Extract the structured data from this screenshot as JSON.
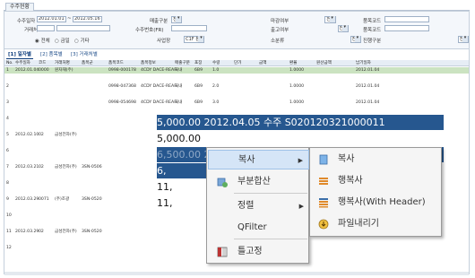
{
  "window": {
    "tab": "수주현황"
  },
  "filter": {
    "date_label": "수주일자",
    "date_from": "2012.01.01",
    "date_sep": "~",
    "date_to": "2012.05.16",
    "client_label": "거래처",
    "radios": [
      "전체",
      "금일",
      "기타"
    ],
    "ship_label": "매출구분",
    "ship_value": "전체",
    "order_label": "수주번호(FR)",
    "biz_label": "사업장",
    "biz_value": "C1F 본사",
    "status1_label": "마감여부",
    "status1_value": "전체",
    "status2_label": "출고여부",
    "status2_value": "전체",
    "status3_label": "소분류",
    "status3_value": "전체",
    "item_label": "품목코드",
    "item2_label": "품목코드",
    "type_label": "진행구분",
    "type_value": "전체"
  },
  "subtabs": [
    "[1] 일자별",
    "[2] 품목별",
    "[3] 거래처별"
  ],
  "grid": {
    "headers": [
      "No.",
      "수주일자",
      "코드",
      "거래처명",
      "품목군",
      "품목코드",
      "품목정보",
      "매출구분",
      "포장",
      "수량",
      "단가",
      "금액",
      "환율",
      "원산금액",
      "납기일자"
    ],
    "rows": [
      [
        "1",
        "2012.01.04",
        "0000",
        "원자재(주)",
        "",
        "0998-000178",
        "4CDY DACE-REAR",
        "국내",
        "6B9",
        "1.0",
        "",
        "",
        "1.0000",
        "",
        "2012.01.04"
      ],
      [
        "2",
        "",
        "",
        "",
        "",
        "0998-047368",
        "4CDY DACE-REAR",
        "국내",
        "6B9",
        "2.0",
        "",
        "",
        "1.0000",
        "",
        "2012.01.04"
      ],
      [
        "3",
        "",
        "",
        "",
        "",
        "0998-054698",
        "4CDY DACE-REAR",
        "국내",
        "6B9",
        "3.0",
        "",
        "",
        "1.0000",
        "",
        "2012.01.04"
      ],
      [
        "4",
        "",
        "",
        "",
        "",
        "",
        "",
        "",
        "",
        "",
        "",
        "",
        "",
        "",
        ""
      ],
      [
        "5",
        "2012.02.10",
        "02",
        "금성전자(주)",
        "",
        "",
        "",
        "",
        "",
        "",
        "",
        "",
        "",
        "",
        ""
      ],
      [
        "6",
        "",
        "",
        "",
        "",
        "",
        "",
        "",
        "",
        "",
        "",
        "",
        "",
        "",
        ""
      ],
      [
        "7",
        "2012.03.21",
        "02",
        "금성전자(주)",
        "3SN-0506",
        "",
        "",
        "",
        "",
        "",
        "",
        "",
        "",
        "",
        ""
      ],
      [
        "8",
        "",
        "",
        "",
        "",
        "",
        "",
        "",
        "",
        "",
        "",
        "",
        "",
        "",
        ""
      ],
      [
        "9",
        "2012.03.29",
        "0071",
        "(주)조광",
        "3SN-0520",
        "",
        "",
        "",
        "",
        "",
        "",
        "",
        "",
        "",
        ""
      ],
      [
        "10",
        "",
        "",
        "",
        "",
        "",
        "",
        "",
        "",
        "",
        "",
        "",
        "",
        "",
        ""
      ],
      [
        "11",
        "2012.03.29",
        "02",
        "금성전자(주)",
        "3SN-0520",
        "",
        "",
        "",
        "",
        "",
        "",
        "",
        "",
        "",
        ""
      ],
      [
        "12",
        "",
        "",
        "",
        "",
        "",
        "",
        "",
        "",
        "",
        "",
        "",
        "",
        "",
        ""
      ]
    ]
  },
  "big_cells": {
    "row1": "5,000.00 2012.04.05 수주 S020120321000011",
    "row2": "5,000.00",
    "row3": "6,500.00 2012.04.05 수주 S020120326000011",
    "row4": "6,",
    "row5": "11,",
    "row6": "11,"
  },
  "context_menu": {
    "items": [
      {
        "label": "복사",
        "icon": "copy-icon",
        "submenu": true
      },
      {
        "label": "부분합산",
        "icon": "subtotal-icon"
      },
      {
        "label": "정렬",
        "icon": "",
        "submenu": true
      },
      {
        "label": "QFilter",
        "icon": ""
      },
      {
        "label": "틀고정",
        "icon": "freeze-pane-icon"
      }
    ]
  },
  "copy_submenu": {
    "items": [
      {
        "label": "복사",
        "icon": "copy-doc-icon"
      },
      {
        "label": "행복사",
        "icon": "row-copy-icon"
      },
      {
        "label": "행복사(With Header)",
        "icon": "row-copy-header-icon"
      },
      {
        "label": "파일내리기",
        "icon": "export-file-icon"
      }
    ]
  }
}
